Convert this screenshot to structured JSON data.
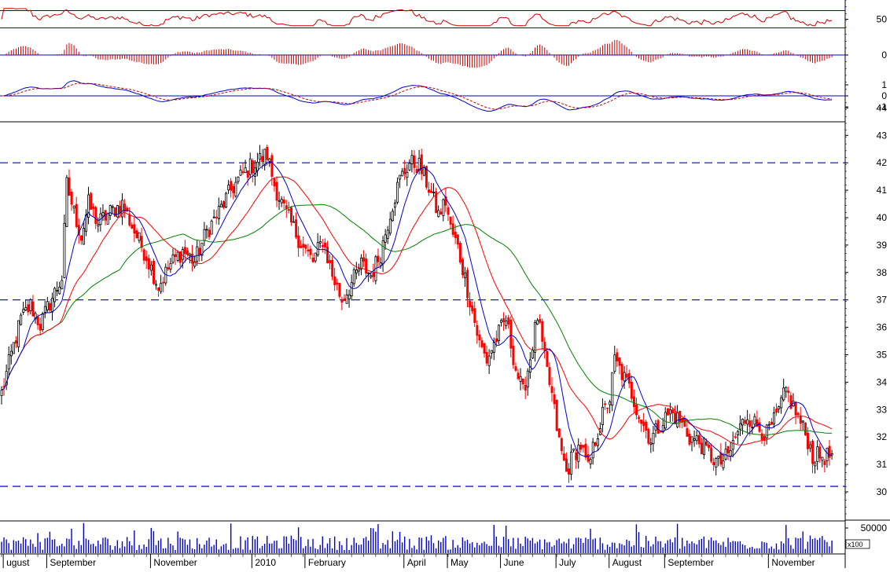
{
  "chart_data": {
    "type": "candlestick",
    "colors": {
      "up": "#000000",
      "down": "#ff0000",
      "ma_fast": "#0000cc",
      "ma_mid": "#ff0000",
      "ma_slow": "#008000",
      "guide": "#0000cc",
      "indicator": "#cc0000",
      "volume": "#0000cc"
    },
    "price_axis": {
      "min": 30,
      "max": 44,
      "ticks": [
        30,
        31,
        32,
        33,
        34,
        35,
        36,
        37,
        38,
        39,
        40,
        41,
        42,
        43,
        44
      ]
    },
    "horizontal_lines": [
      42,
      37,
      30.2
    ],
    "months": [
      {
        "label": "ugust",
        "idx": 2
      },
      {
        "label": "September",
        "idx": 20
      },
      {
        "label": "November",
        "idx": 63
      },
      {
        "label": "2010",
        "idx": 105
      },
      {
        "label": "February",
        "idx": 127
      },
      {
        "label": "April",
        "idx": 168
      },
      {
        "label": "May",
        "idx": 186
      },
      {
        "label": "June",
        "idx": 208
      },
      {
        "label": "July",
        "idx": 231
      },
      {
        "label": "August",
        "idx": 253
      },
      {
        "label": "September",
        "idx": 276
      },
      {
        "label": "November",
        "idx": 319
      }
    ],
    "close_anchors": [
      [
        0,
        33.6
      ],
      [
        4,
        35.0
      ],
      [
        8,
        36.3
      ],
      [
        12,
        36.8
      ],
      [
        16,
        36.1
      ],
      [
        20,
        36.9
      ],
      [
        25,
        37.8
      ],
      [
        27,
        41.2
      ],
      [
        30,
        40.2
      ],
      [
        33,
        39.3
      ],
      [
        36,
        40.5
      ],
      [
        40,
        39.8
      ],
      [
        45,
        40.2
      ],
      [
        50,
        40.5
      ],
      [
        55,
        39.5
      ],
      [
        60,
        38.6
      ],
      [
        65,
        37.5
      ],
      [
        70,
        38.3
      ],
      [
        75,
        38.8
      ],
      [
        80,
        38.4
      ],
      [
        85,
        39.5
      ],
      [
        90,
        40.2
      ],
      [
        95,
        41.0
      ],
      [
        100,
        41.6
      ],
      [
        105,
        42.0
      ],
      [
        110,
        42.3
      ],
      [
        113,
        41.2
      ],
      [
        117,
        40.3
      ],
      [
        121,
        39.6
      ],
      [
        125,
        38.9
      ],
      [
        129,
        38.4
      ],
      [
        133,
        39.2
      ],
      [
        137,
        37.9
      ],
      [
        141,
        37.0
      ],
      [
        145,
        37.6
      ],
      [
        149,
        38.3
      ],
      [
        153,
        37.9
      ],
      [
        157,
        38.7
      ],
      [
        161,
        40.2
      ],
      [
        165,
        41.4
      ],
      [
        169,
        42.0
      ],
      [
        173,
        41.9
      ],
      [
        177,
        41.1
      ],
      [
        181,
        40.1
      ],
      [
        184,
        40.6
      ],
      [
        186,
        39.6
      ],
      [
        189,
        38.9
      ],
      [
        192,
        37.8
      ],
      [
        195,
        36.6
      ],
      [
        198,
        35.4
      ],
      [
        201,
        34.8
      ],
      [
        205,
        35.6
      ],
      [
        209,
        36.3
      ],
      [
        213,
        34.5
      ],
      [
        216,
        33.6
      ],
      [
        219,
        34.9
      ],
      [
        222,
        36.4
      ],
      [
        225,
        34.8
      ],
      [
        228,
        33.5
      ],
      [
        231,
        31.8
      ],
      [
        234,
        30.7
      ],
      [
        237,
        31.4
      ],
      [
        240,
        31.7
      ],
      [
        243,
        30.8
      ],
      [
        246,
        31.9
      ],
      [
        249,
        32.8
      ],
      [
        252,
        33.4
      ],
      [
        254,
        34.8
      ],
      [
        257,
        34.3
      ],
      [
        261,
        33.6
      ],
      [
        265,
        32.6
      ],
      [
        269,
        31.9
      ],
      [
        273,
        32.5
      ],
      [
        277,
        32.9
      ],
      [
        281,
        32.6
      ],
      [
        285,
        32.0
      ],
      [
        289,
        31.8
      ],
      [
        293,
        31.4
      ],
      [
        297,
        31.0
      ],
      [
        301,
        31.3
      ],
      [
        305,
        32.2
      ],
      [
        309,
        32.8
      ],
      [
        313,
        32.4
      ],
      [
        317,
        32.1
      ],
      [
        321,
        32.7
      ],
      [
        325,
        33.7
      ],
      [
        328,
        33.1
      ],
      [
        331,
        32.5
      ],
      [
        334,
        31.9
      ],
      [
        336,
        31.3
      ]
    ],
    "rsi": {
      "ticks": [
        50
      ],
      "upper": 70,
      "lower": 30,
      "range": [
        0,
        100
      ]
    },
    "histogram": {
      "ticks": [
        0
      ]
    },
    "macd": {
      "ticks": [
        1,
        0,
        -1
      ]
    },
    "volume": {
      "ticks": [
        50000
      ],
      "multiplier": "x100"
    }
  }
}
